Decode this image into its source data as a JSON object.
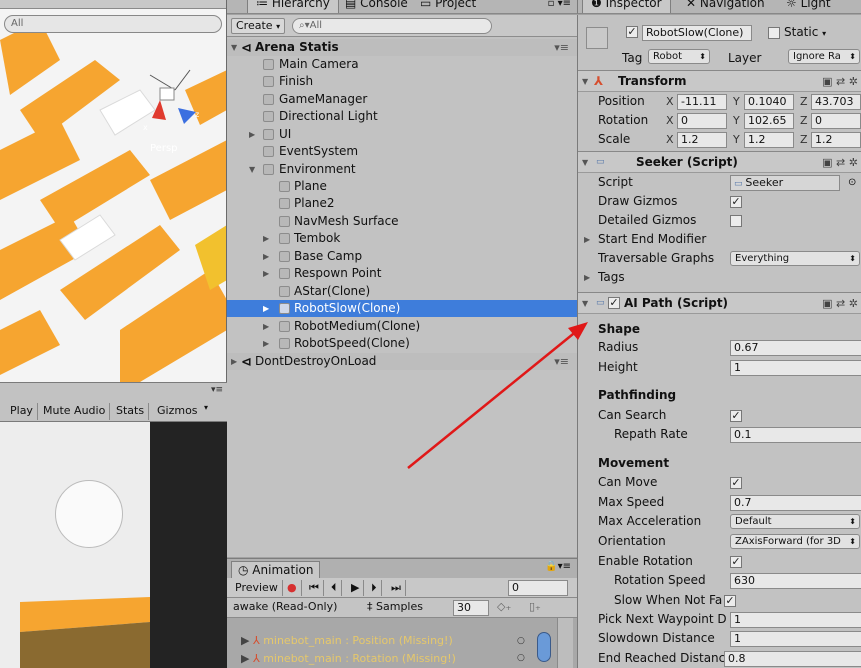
{
  "scene": {
    "search": "All",
    "persp_label": "Persp"
  },
  "game_toolbar": {
    "buttons": [
      "Play",
      "Mute Audio",
      "Stats",
      "Gizmos"
    ]
  },
  "hierarchy": {
    "tabs": [
      "Hierarchy",
      "Console",
      "Project"
    ],
    "create_label": "Create",
    "search_placeholder": "All",
    "scene_root": "Arena Statis",
    "items": [
      {
        "label": "Main Camera"
      },
      {
        "label": "Finish"
      },
      {
        "label": "GameManager"
      },
      {
        "label": "Directional Light"
      },
      {
        "label": "UI"
      },
      {
        "label": "EventSystem"
      },
      {
        "label": "Environment"
      },
      {
        "label": "Plane"
      },
      {
        "label": "Plane2"
      },
      {
        "label": "NavMesh Surface"
      },
      {
        "label": "Tembok"
      },
      {
        "label": "Base Camp"
      },
      {
        "label": "Respown Point"
      },
      {
        "label": "AStar(Clone)"
      },
      {
        "label": "RobotSlow(Clone)"
      },
      {
        "label": "RobotMedium(Clone)"
      },
      {
        "label": "RobotSpeed(Clone)"
      }
    ],
    "dont_destroy": "DontDestroyOnLoad"
  },
  "animation": {
    "tab": "Animation",
    "preview": "Preview",
    "frame": "0",
    "clip": "awake (Read-Only)",
    "samples_label": "Samples",
    "samples_value": "30",
    "tracks": [
      "minebot_main : Position (Missing!)",
      "minebot_main : Rotation (Missing!)"
    ]
  },
  "inspector": {
    "tabs": [
      "Inspector",
      "Navigation",
      "Light"
    ],
    "object_name": "RobotSlow(Clone)",
    "static_label": "Static",
    "tag_label": "Tag",
    "tag_value": "Robot",
    "layer_label": "Layer",
    "layer_value": "Ignore Ra",
    "transform": {
      "title": "Transform",
      "position_label": "Position",
      "position": [
        "-11.11",
        "0.1040",
        "43.703"
      ],
      "rotation_label": "Rotation",
      "rotation": [
        "0",
        "102.65",
        "0"
      ],
      "scale_label": "Scale",
      "scale": [
        "1.2",
        "1.2",
        "1.2"
      ]
    },
    "seeker": {
      "title": "Seeker (Script)",
      "script_label": "Script",
      "script_value": "Seeker",
      "draw_gizmos": "Draw Gizmos",
      "detailed_gizmos": "Detailed Gizmos",
      "start_end": "Start End Modifier",
      "traversable": "Traversable Graphs",
      "traversable_value": "Everything",
      "tags": "Tags"
    },
    "aipath": {
      "title": "AI Path (Script)",
      "shape": "Shape",
      "radius_label": "Radius",
      "radius": "0.67",
      "height_label": "Height",
      "height": "1",
      "pathfinding": "Pathfinding",
      "can_search": "Can Search",
      "repath_label": "Repath Rate",
      "repath": "0.1",
      "movement": "Movement",
      "can_move": "Can Move",
      "max_speed_label": "Max Speed",
      "max_speed": "0.7",
      "max_accel_label": "Max Acceleration",
      "max_accel": "Default",
      "orientation_label": "Orientation",
      "orientation": "ZAxisForward (for 3D",
      "enable_rotation": "Enable Rotation",
      "rot_speed_label": "Rotation Speed",
      "rot_speed": "630",
      "slow_label": "Slow When Not Fa",
      "pick_next_label": "Pick Next Waypoint D",
      "pick_next": "1",
      "slowdown_label": "Slowdown Distance",
      "slowdown": "1",
      "end_reached_label": "End Reached Distanc",
      "end_reached": "0.8"
    }
  },
  "colors": {
    "selection": "#3e7ddb",
    "annotation_arrow": "#e01818"
  }
}
